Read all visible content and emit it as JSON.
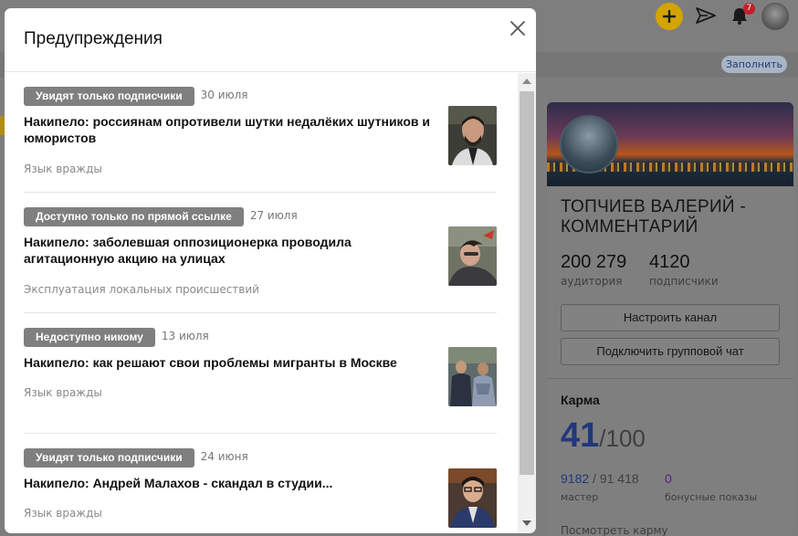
{
  "modal": {
    "title": "Предупреждения",
    "items": [
      {
        "badge": "Увидят только подписчики",
        "date": "30 июля",
        "title": "Накипело: россиянам опротивели шутки недалёких шутников и юмористов",
        "reason": "Язык вражды"
      },
      {
        "badge": "Доступно только по прямой ссылке",
        "date": "27 июля",
        "title": "Накипело: заболевшая оппозиционерка проводила агитационную акцию на улицах",
        "reason": "Эксплуатация локальных происшествий"
      },
      {
        "badge": "Недоступно никому",
        "date": "13 июля",
        "title": "Накипело: как решают свои проблемы мигранты в Москве",
        "reason": "Язык вражды"
      },
      {
        "badge": "Увидят только подписчики",
        "date": "24 июня",
        "title": "Накипело: Андрей Малахов - скандал в студии...",
        "reason": "Язык вражды"
      }
    ]
  },
  "header": {
    "fill_label": "Заполнить",
    "notifications_count": "7"
  },
  "channel": {
    "name": "ТОПЧИЕВ ВАЛЕРИЙ - КОММЕНТАРИЙ",
    "audience_value": "200 279",
    "audience_label": "аудитория",
    "subscribers_value": "4120",
    "subscribers_label": "подписчики",
    "setup_button": "Настроить канал",
    "chat_button": "Подключить групповой чат",
    "karma_title": "Карма",
    "karma_value": "41",
    "karma_max": "/100",
    "master_value": "9182",
    "master_total": " / 91 418",
    "master_label": "мастер",
    "bonus_value": "0",
    "bonus_label": "бонусные показы",
    "karma_link": "Посмотреть карму"
  },
  "colors": {
    "badge_bg": "#7f7f7f",
    "accent_yellow": "#d3a300",
    "karma_blue": "#22377c",
    "bonus_purple": "#5a1c7a"
  }
}
